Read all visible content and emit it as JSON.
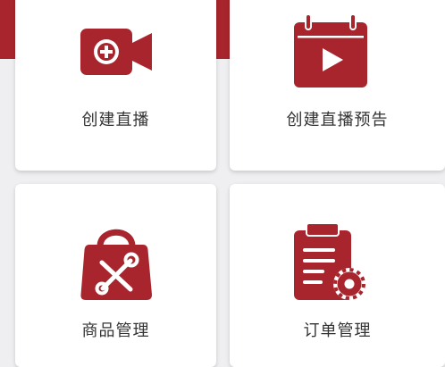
{
  "theme": {
    "accent": "#a8252d",
    "background": "#efeff1",
    "card": "#ffffff",
    "text": "#333333"
  },
  "menu": {
    "create_live": {
      "label": "创建直播",
      "icon": "video-camera-plus-icon"
    },
    "create_preview": {
      "label": "创建直播预告",
      "icon": "calendar-play-icon"
    },
    "products": {
      "label": "商品管理",
      "icon": "shopping-bag-tools-icon"
    },
    "orders": {
      "label": "订单管理",
      "icon": "clipboard-gear-icon"
    }
  }
}
